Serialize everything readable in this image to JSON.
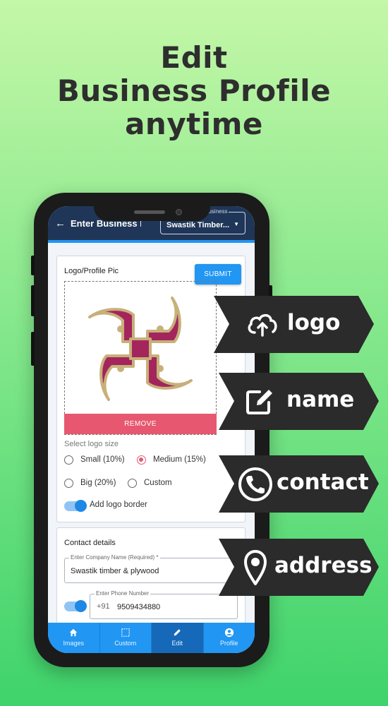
{
  "headline": [
    "Edit",
    "Business Profile",
    "anytime"
  ],
  "appbar": {
    "title": "Enter Business De...",
    "business_select_label": "Business",
    "business_select_value": "Swastik Timber..."
  },
  "logo_card": {
    "title": "Logo/Profile Pic",
    "submit_label": "SUBMIT",
    "remove_label": "REMOVE",
    "size_label": "Select logo size",
    "size_options": [
      "Small (10%)",
      "Medium (15%)",
      "Big (20%)",
      "Custom"
    ],
    "selected_size": "Medium (15%)",
    "border_toggle_label": "Add logo border",
    "border_toggle_on": true
  },
  "contact_card": {
    "title": "Contact details",
    "company_label": "Enter Company Name (Required) *",
    "company_value": "Swastik timber & plywood",
    "phone_label": "Enter Phone Number",
    "phone_prefix": "+91",
    "phone_value": "9509434880",
    "phone_toggle_on": true
  },
  "bottom_nav": [
    {
      "label": "Images",
      "icon": "home-icon"
    },
    {
      "label": "Custom",
      "icon": "custom-frame-icon"
    },
    {
      "label": "Edit",
      "icon": "pencil-icon",
      "active": true
    },
    {
      "label": "Profile",
      "icon": "person-icon"
    }
  ],
  "feature_ribbons": [
    {
      "label": "logo",
      "icon": "cloud-upload-icon"
    },
    {
      "label": "name",
      "icon": "edit-square-icon"
    },
    {
      "label": "contact",
      "icon": "phone-circle-icon"
    },
    {
      "label": "address",
      "icon": "location-pin-icon"
    }
  ],
  "colors": {
    "accent": "#2196f3",
    "appbar": "#1f3658",
    "remove": "#e75870",
    "ribbon": "#2b2b2b",
    "headline": "#2e2e2e"
  }
}
